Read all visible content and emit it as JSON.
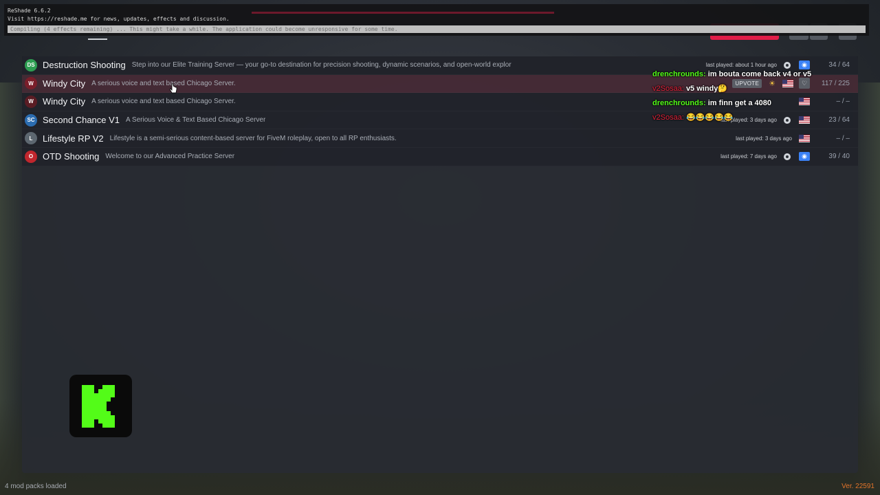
{
  "reshade": {
    "title": "ReShade 6.6.2",
    "info": "Visit https://reshade.me for news, updates, effects and discussion.",
    "progress": "Compiling (4 effects remaining) ... This might take a while. The application could become unresponsive for some time."
  },
  "servers": [
    {
      "icon": "DS",
      "icon_color": "#2e9e52",
      "name": "Destruction Shooting",
      "desc": "Step into our Elite Training Server — your go-to destination for precision shooting, dynamic scenarios, and open-world explor",
      "last_played": "last played: about 1 hour ago",
      "players": "34 / 64"
    },
    {
      "icon": "W",
      "icon_color": "#7a1e2a",
      "name": "Windy City",
      "desc": "A serious voice and text based Chicago Server.",
      "upvote": "UPVOTE",
      "players": "117 / 225"
    },
    {
      "icon": "W",
      "icon_color": "#5a1c24",
      "name": "Windy City",
      "desc": "A serious voice and text based Chicago Server.",
      "players": "– / –"
    },
    {
      "icon": "SC",
      "icon_color": "#2b6cb0",
      "name": "Second Chance V1",
      "desc": "A Serious Voice & Text Based Chicago Server",
      "last_played": "last played: 3 days ago",
      "players": "23 / 64"
    },
    {
      "icon": "L",
      "icon_color": "#5d6770",
      "name": "Lifestyle RP V2",
      "desc": "Lifestyle is a semi-serious content-based server for FiveM roleplay, open to all RP enthusiasts.",
      "last_played": "last played: 3 days ago",
      "players": "– / –"
    },
    {
      "icon": "O",
      "icon_color": "#c0262d",
      "name": "OTD Shooting",
      "desc": "Welcome to our Advanced Practice Server",
      "last_played": "last played: 7 days ago",
      "players": "39 / 40"
    }
  ],
  "chat": [
    {
      "user": "drenchrounds:",
      "text": "im bouta come back v4 or v5",
      "user_color": "green"
    },
    {
      "user": "v2Sosaa:",
      "text": "v5 windy🤔",
      "user_color": "red"
    },
    {
      "user": "drenchrounds:",
      "text": "im finn get a 4080",
      "user_color": "green"
    },
    {
      "user": "v2Sosaa:",
      "text": "😂😂😂😂😂",
      "user_color": "red"
    }
  ],
  "footer": {
    "mod_packs": "4 mod packs loaded",
    "version": "Ver. 22591"
  },
  "colors": {
    "accent": "#e11d48",
    "kick_green": "#53fc18",
    "version": "#e2742a"
  }
}
